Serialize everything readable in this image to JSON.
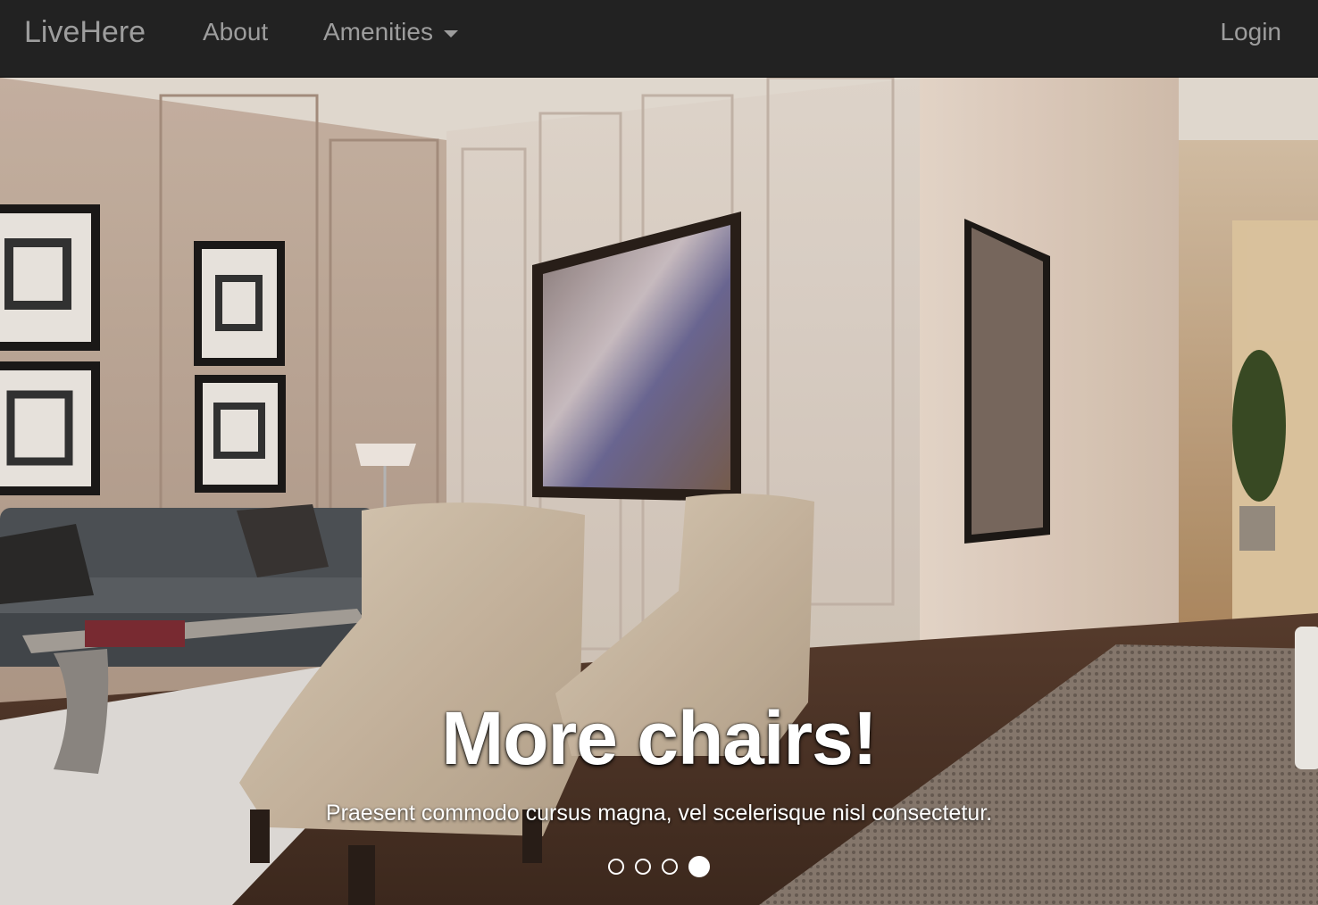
{
  "navbar": {
    "brand": "LiveHere",
    "about_label": "About",
    "amenities_label": "Amenities",
    "login_label": "Login"
  },
  "carousel": {
    "title": "More chairs!",
    "subtitle": "Praesent commodo cursus magna, vel scelerisque nisl consectetur.",
    "slide_count": 4,
    "active_slide": 4,
    "image_description": "lobby-interior-photo"
  },
  "colors": {
    "navbar_bg": "#222222",
    "nav_text": "#9d9d9d",
    "caption_text": "#ffffff"
  }
}
